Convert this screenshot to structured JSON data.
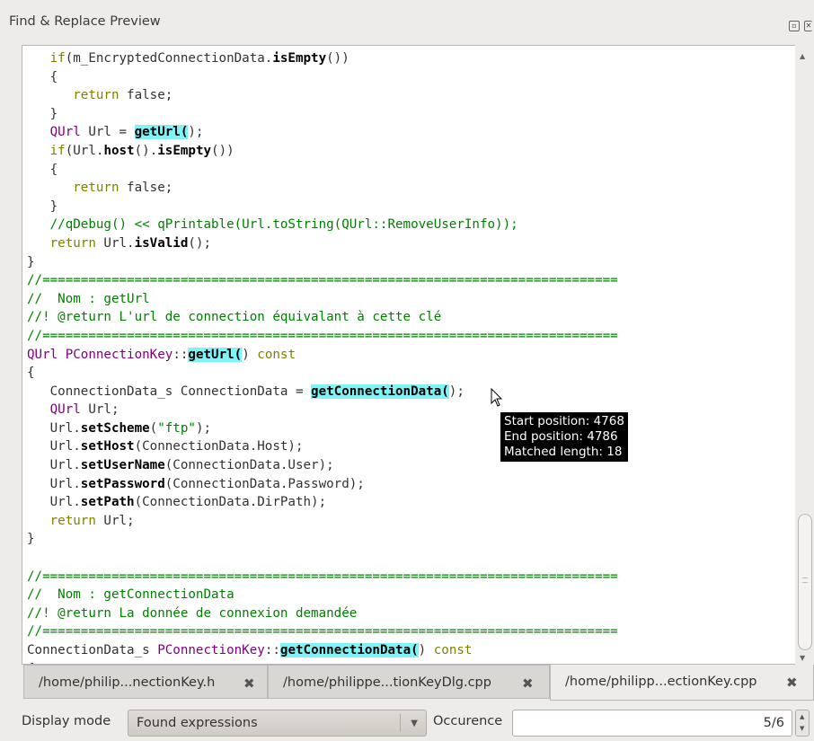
{
  "window": {
    "title": "Find & Replace Preview",
    "float_icon": "float-icon",
    "close_icon": "close-icon"
  },
  "code_lines": [
    [
      {
        "t": "   "
      },
      {
        "t": "if",
        "c": "kw"
      },
      {
        "t": "(m_EncryptedConnectionData."
      },
      {
        "t": "isEmpty",
        "c": "fn"
      },
      {
        "t": "())"
      }
    ],
    [
      {
        "t": "   {"
      }
    ],
    [
      {
        "t": "      "
      },
      {
        "t": "return",
        "c": "kw"
      },
      {
        "t": " false;"
      }
    ],
    [
      {
        "t": "   }"
      }
    ],
    [
      {
        "t": "   "
      },
      {
        "t": "QUrl",
        "c": "ty"
      },
      {
        "t": " Url = "
      },
      {
        "t": "getUrl(",
        "c": "fn hl"
      },
      {
        "t": ");"
      }
    ],
    [
      {
        "t": "   "
      },
      {
        "t": "if",
        "c": "kw"
      },
      {
        "t": "(Url."
      },
      {
        "t": "host",
        "c": "fn"
      },
      {
        "t": "()."
      },
      {
        "t": "isEmpty",
        "c": "fn"
      },
      {
        "t": "())"
      }
    ],
    [
      {
        "t": "   {"
      }
    ],
    [
      {
        "t": "      "
      },
      {
        "t": "return",
        "c": "kw"
      },
      {
        "t": " false;"
      }
    ],
    [
      {
        "t": "   }"
      }
    ],
    [
      {
        "t": "   //qDebug() << qPrintable(Url.toString(QUrl::RemoveUserInfo));",
        "c": "cm"
      }
    ],
    [
      {
        "t": "   "
      },
      {
        "t": "return",
        "c": "kw"
      },
      {
        "t": " Url."
      },
      {
        "t": "isValid",
        "c": "fn"
      },
      {
        "t": "();"
      }
    ],
    [
      {
        "t": "}"
      }
    ],
    [
      {
        "t": "//===========================================================================",
        "c": "cm"
      }
    ],
    [
      {
        "t": "//  Nom : getUrl",
        "c": "cm"
      }
    ],
    [
      {
        "t": "//! @return L'url de connection équivalant à cette clé",
        "c": "cm"
      }
    ],
    [
      {
        "t": "//===========================================================================",
        "c": "cm"
      }
    ],
    [
      {
        "t": "QUrl",
        "c": "ty"
      },
      {
        "t": " "
      },
      {
        "t": "PConnectionKey",
        "c": "ty"
      },
      {
        "t": "::"
      },
      {
        "t": "getUrl(",
        "c": "fn hl"
      },
      {
        "t": ") "
      },
      {
        "t": "const",
        "c": "kw"
      }
    ],
    [
      {
        "t": "{"
      }
    ],
    [
      {
        "t": "   ConnectionData_s ConnectionData = "
      },
      {
        "t": "getConnectionData(",
        "c": "fn hl"
      },
      {
        "t": ");"
      }
    ],
    [
      {
        "t": "   "
      },
      {
        "t": "QUrl",
        "c": "ty"
      },
      {
        "t": " Url;"
      }
    ],
    [
      {
        "t": "   Url."
      },
      {
        "t": "setScheme",
        "c": "fn"
      },
      {
        "t": "("
      },
      {
        "t": "\"ftp\"",
        "c": "st"
      },
      {
        "t": ");"
      }
    ],
    [
      {
        "t": "   Url."
      },
      {
        "t": "setHost",
        "c": "fn"
      },
      {
        "t": "(ConnectionData.Host);"
      }
    ],
    [
      {
        "t": "   Url."
      },
      {
        "t": "setUserName",
        "c": "fn"
      },
      {
        "t": "(ConnectionData.User);"
      }
    ],
    [
      {
        "t": "   Url."
      },
      {
        "t": "setPassword",
        "c": "fn"
      },
      {
        "t": "(ConnectionData.Password);"
      }
    ],
    [
      {
        "t": "   Url."
      },
      {
        "t": "setPath",
        "c": "fn"
      },
      {
        "t": "(ConnectionData.DirPath);"
      }
    ],
    [
      {
        "t": "   "
      },
      {
        "t": "return",
        "c": "kw"
      },
      {
        "t": " Url;"
      }
    ],
    [
      {
        "t": "}"
      }
    ],
    [
      {
        "t": ""
      }
    ],
    [
      {
        "t": "//===========================================================================",
        "c": "cm"
      }
    ],
    [
      {
        "t": "//  Nom : getConnectionData",
        "c": "cm"
      }
    ],
    [
      {
        "t": "//! @return La donnée de connexion demandée",
        "c": "cm"
      }
    ],
    [
      {
        "t": "//===========================================================================",
        "c": "cm"
      }
    ],
    [
      {
        "t": "ConnectionData_s "
      },
      {
        "t": "PConnectionKey",
        "c": "ty"
      },
      {
        "t": "::"
      },
      {
        "t": "getConnectionData(",
        "c": "fn hl"
      },
      {
        "t": ") "
      },
      {
        "t": "const",
        "c": "kw"
      }
    ],
    [
      {
        "t": "{"
      }
    ]
  ],
  "tooltip": {
    "start": "Start position: 4768",
    "end": "End position: 4786",
    "length": "Matched length: 18"
  },
  "tabs": [
    {
      "label": "/home/philip...nectionKey.h",
      "active": false
    },
    {
      "label": "/home/philippe...tionKeyDlg.cpp",
      "active": false
    },
    {
      "label": "/home/philipp...ectionKey.cpp",
      "active": true
    }
  ],
  "controls": {
    "display_mode_label": "Display mode",
    "display_mode_value": "Found expressions",
    "occurence_label": "Occurence",
    "occurence_value": "5/6"
  }
}
